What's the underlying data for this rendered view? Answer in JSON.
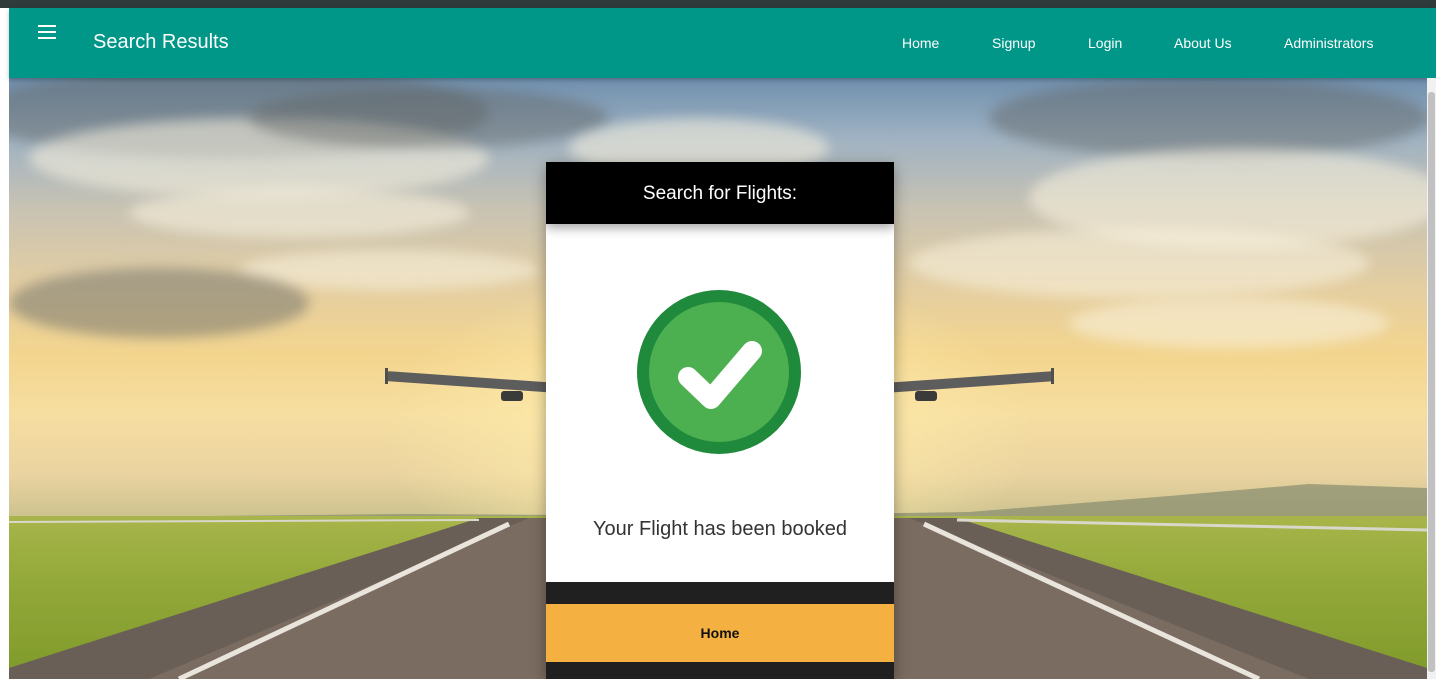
{
  "navbar": {
    "title": "Search Results",
    "menu_icon": "hamburger-menu-icon",
    "links": [
      "Home",
      "Signup",
      "Login",
      "About Us",
      "Administrators"
    ],
    "color": "#009688"
  },
  "card": {
    "header": "Search for Flights:",
    "status_icon": "success-check-icon",
    "message": "Your Flight has been booked",
    "home_button": "Home",
    "accent": "#f4b142",
    "success_color": "#3fae49"
  }
}
